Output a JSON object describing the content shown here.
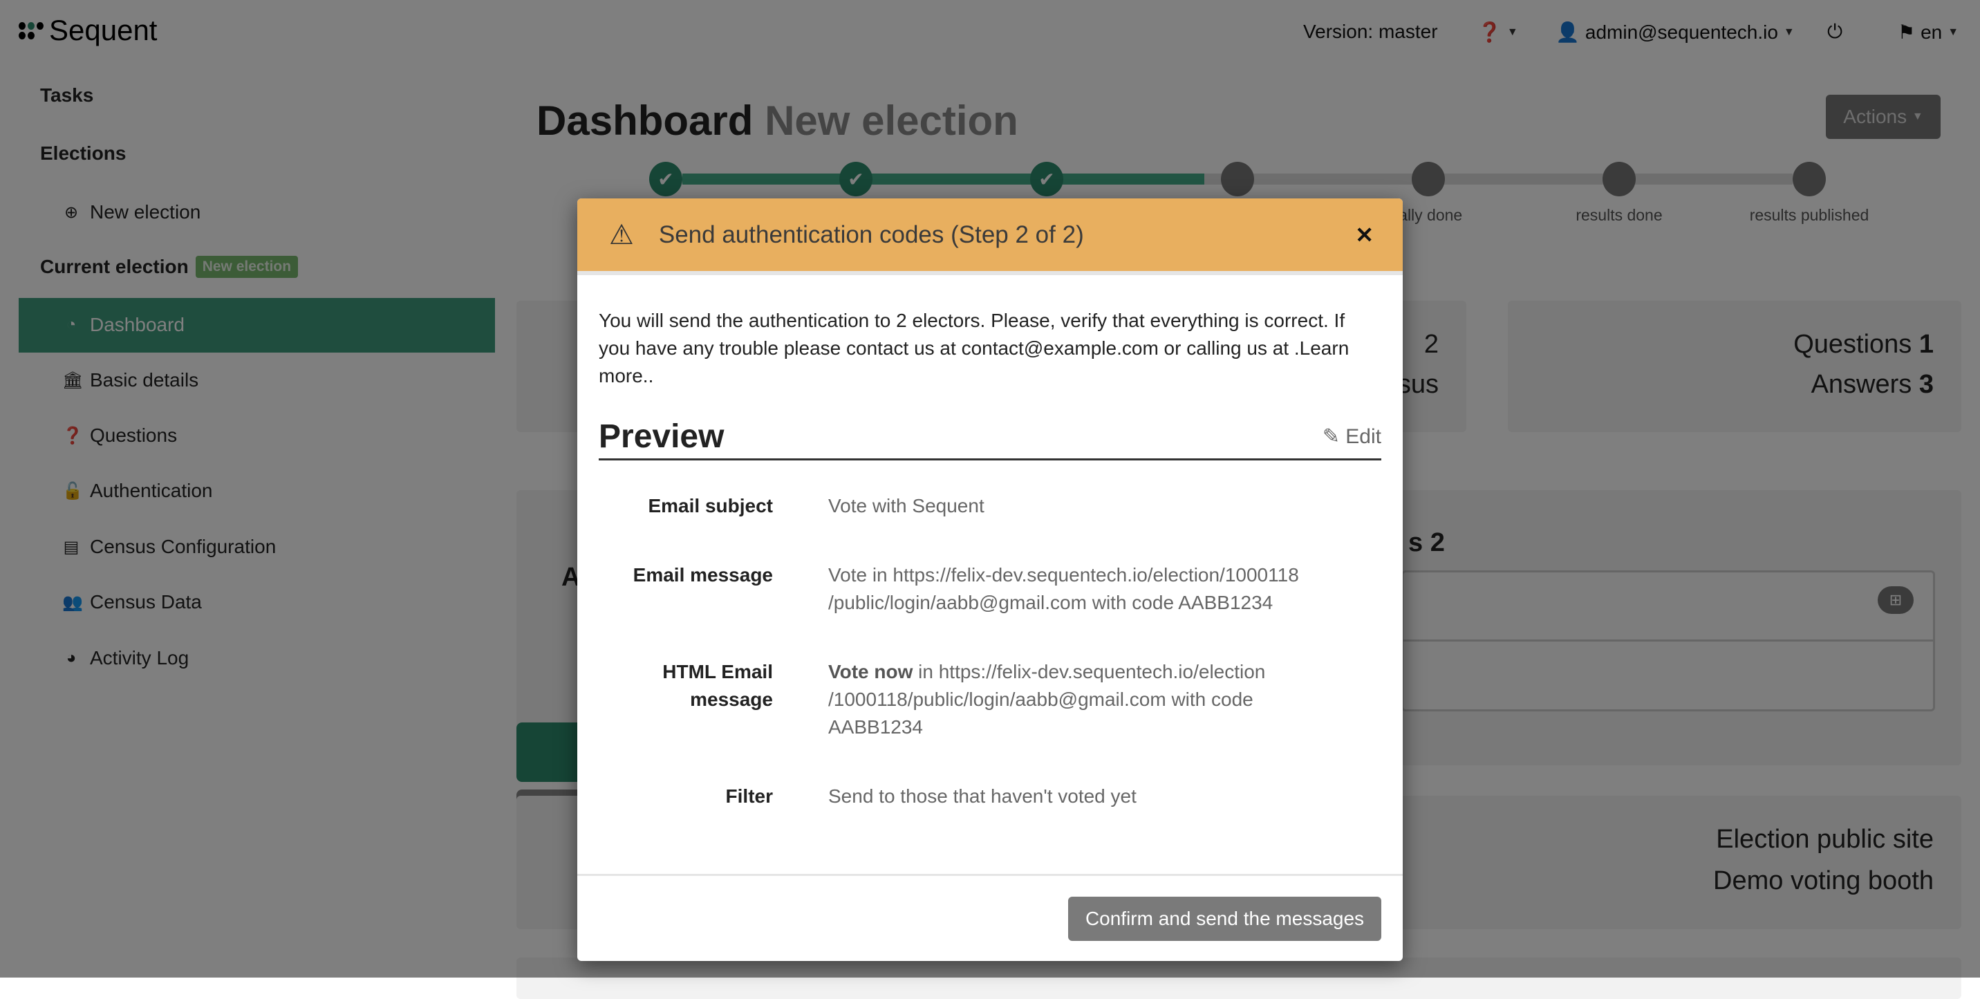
{
  "brand": {
    "name": "Sequent",
    "accent": "#44aa88"
  },
  "topnav": {
    "version": "Version: master",
    "help_icon": "question-circle-icon",
    "user": "admin@sequentech.io",
    "power_icon": "power-icon",
    "language": "en"
  },
  "sidebar": {
    "tasks": "Tasks",
    "elections": "Elections",
    "new_election": "New election",
    "current_election": "Current election",
    "current_badge": "New election",
    "items": [
      {
        "label": "Dashboard",
        "icon": "dashboard-icon"
      },
      {
        "label": "Basic details",
        "icon": "bank-icon"
      },
      {
        "label": "Questions",
        "icon": "question-icon"
      },
      {
        "label": "Authentication",
        "icon": "unlock-icon"
      },
      {
        "label": "Census Configuration",
        "icon": "id-card-icon"
      },
      {
        "label": "Census Data",
        "icon": "users-icon"
      },
      {
        "label": "Activity Log",
        "icon": "pie-chart-icon"
      }
    ]
  },
  "main": {
    "title": "Dashboard",
    "subtitle": "New election",
    "actions": "Actions",
    "steps": [
      {
        "label": "",
        "done": true
      },
      {
        "label": "",
        "done": true
      },
      {
        "label": "",
        "done": true
      },
      {
        "label": "",
        "done": false
      },
      {
        "label": "tally done",
        "done": false
      },
      {
        "label": "results done",
        "done": false
      },
      {
        "label": "results published",
        "done": false
      }
    ],
    "progress_percent": 47,
    "card1": {
      "line1": "2",
      "line2": "Census"
    },
    "card2": {
      "line1_label": "Questions",
      "line1_value": "1",
      "line2_label": "Answers",
      "line2_value": "3"
    },
    "card3": {
      "left": "A",
      "right": "s 2"
    },
    "card4": {
      "line1": "Election public site",
      "line2": "Demo voting booth"
    }
  },
  "modal": {
    "title": "Send authentication codes (Step 2 of 2)",
    "intro": "You will send the authentication to 2 electors. Please, verify that everything is correct. If you have any trouble please contact us at contact@example.com or calling us at .Learn more..",
    "preview_heading": "Preview",
    "edit": "Edit",
    "rows": [
      {
        "label": "Email subject",
        "value": "Vote with Sequent"
      },
      {
        "label": "Email message",
        "value": "Vote in https://felix-dev.sequentech.io/election/1000118 /public/login/aabb@gmail.com with code AABB1234"
      },
      {
        "label": "HTML Email message",
        "bold": "Vote now",
        "value": " in https://felix-dev.sequentech.io/election /1000118/public/login/aabb@gmail.com with code AABB1234"
      },
      {
        "label": "Filter",
        "value": "Send to those that haven't voted yet"
      }
    ],
    "confirm": "Confirm and send the messages"
  }
}
